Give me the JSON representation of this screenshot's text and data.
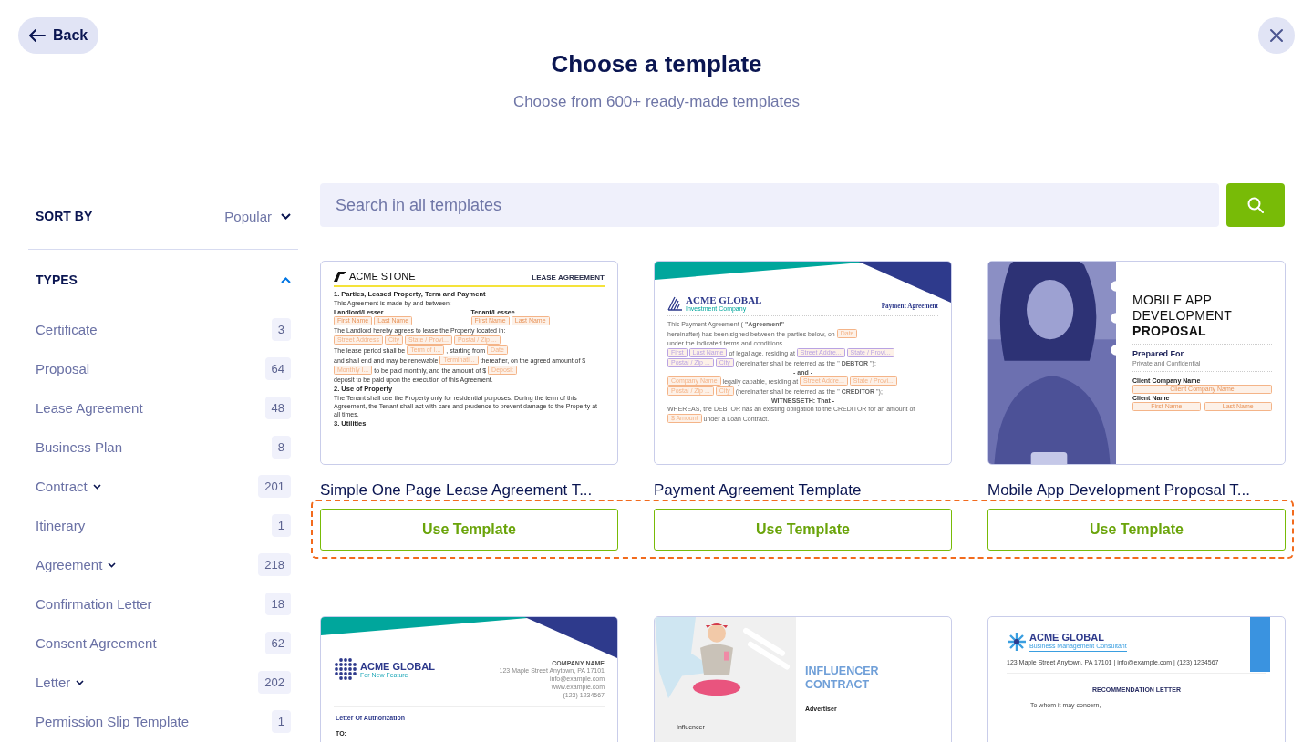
{
  "header": {
    "back": "Back",
    "title": "Choose a template",
    "subtitle": "Choose from 600+ ready-made templates"
  },
  "sidebar": {
    "sort_label": "SORT BY",
    "sort_value": "Popular",
    "types_label": "TYPES",
    "types_expanded": true,
    "types": [
      {
        "label": "Certificate",
        "count": "3",
        "expandable": false
      },
      {
        "label": "Proposal",
        "count": "64",
        "expandable": false
      },
      {
        "label": "Lease Agreement",
        "count": "48",
        "expandable": false
      },
      {
        "label": "Business Plan",
        "count": "8",
        "expandable": false
      },
      {
        "label": "Contract",
        "count": "201",
        "expandable": true
      },
      {
        "label": "Itinerary",
        "count": "1",
        "expandable": false
      },
      {
        "label": "Agreement",
        "count": "218",
        "expandable": true
      },
      {
        "label": "Confirmation Letter",
        "count": "18",
        "expandable": false
      },
      {
        "label": "Consent Agreement",
        "count": "62",
        "expandable": false
      },
      {
        "label": "Letter",
        "count": "202",
        "expandable": true
      },
      {
        "label": "Permission Slip Template",
        "count": "1",
        "expandable": false
      }
    ]
  },
  "search": {
    "placeholder": "Search in all templates"
  },
  "highlight_first_row_buttons": true,
  "templates": [
    {
      "title": "Simple One Page Lease Agreement T...",
      "button": "Use Template",
      "preview": {
        "kind": "lease",
        "brand": "ACME STONE",
        "doc_title": "LEASE AGREEMENT",
        "blocks": [
          {
            "kind": "heading",
            "text": "1. Parties, Leased Property, Term and Payment"
          },
          {
            "kind": "para",
            "parts": [
              {
                "kind": "text",
                "text": "This Agreement is made by and between:"
              }
            ]
          },
          {
            "kind": "split",
            "columns": [
              {
                "label": "Landlord/Lesser",
                "fields": [
                  "First Name",
                  "Last Name"
                ]
              },
              {
                "label": "Tenant/Lessee",
                "fields": [
                  "First Name",
                  "Last Name"
                ]
              }
            ]
          },
          {
            "kind": "para",
            "parts": [
              {
                "kind": "text",
                "text": "The Landlord hereby agrees to lease the Property located in:"
              }
            ]
          },
          {
            "kind": "para",
            "parts": [
              {
                "kind": "field",
                "text": "Street Address",
                "color": "#f4b488"
              },
              {
                "kind": "field",
                "text": "City",
                "color": "#f4b488"
              },
              {
                "kind": "field",
                "text": "State / Provi...",
                "color": "#f4b488"
              },
              {
                "kind": "field",
                "text": "Postal / Zip ...",
                "color": "#f4b488"
              }
            ]
          },
          {
            "kind": "para",
            "parts": [
              {
                "kind": "text",
                "text": "The lease period shall be"
              },
              {
                "kind": "field",
                "text": "Term of I...",
                "color": "#f4b488"
              },
              {
                "kind": "text",
                "text": ", starting from"
              },
              {
                "kind": "field",
                "text": "Date",
                "color": "#f4b488"
              },
              {
                "kind": "text",
                "text": "and shall end and may be renewable"
              },
              {
                "kind": "field",
                "text": "Terminati...",
                "color": "#f4b488"
              },
              {
                "kind": "text",
                "text": "thereafter, on the agreed amount of $"
              },
              {
                "kind": "field",
                "text": "Monthly I...",
                "color": "#f4b488"
              },
              {
                "kind": "text",
                "text": "to be paid monthly, and the amount of $"
              },
              {
                "kind": "field",
                "text": "Deposit",
                "color": "#f4b488"
              },
              {
                "kind": "text",
                "text": "deposit to be paid upon the execution of this Agreement."
              }
            ]
          },
          {
            "kind": "heading",
            "text": "2. Use of Property"
          },
          {
            "kind": "para",
            "parts": [
              {
                "kind": "text",
                "text": "The Tenant shall use the Property only for residential purposes. During the term of this Agreement, the Tenant shall act with care and prudence to prevent damage to the Property at all times."
              }
            ]
          },
          {
            "kind": "heading",
            "text": "3. Utilities"
          }
        ]
      }
    },
    {
      "title": "Payment Agreement Template",
      "button": "Use Template",
      "preview": {
        "kind": "payment",
        "brand": "ACME GLOBAL",
        "tagline": "Investment Company",
        "doc_title": "Payment Agreement",
        "blocks": [
          {
            "kind": "para",
            "parts": [
              {
                "kind": "text",
                "text": "This Payment Agreement ("
              },
              {
                "kind": "strong",
                "text": "\"Agreement\""
              },
              {
                "kind": "text",
                "text": "hereinafter) has been signed between the parties below, on"
              },
              {
                "kind": "field",
                "text": "Date",
                "color": "#f4b488"
              },
              {
                "kind": "text",
                "text": "under the indicated terms and conditions."
              }
            ]
          },
          {
            "kind": "para",
            "parts": [
              {
                "kind": "field",
                "text": "First",
                "color": "#b9a3e3"
              },
              {
                "kind": "field",
                "text": "Last Name",
                "color": "#b9a3e3"
              },
              {
                "kind": "text",
                "text": "of legal age, residing at"
              },
              {
                "kind": "field",
                "text": "Street Addre...",
                "color": "#b9a3e3"
              },
              {
                "kind": "field",
                "text": "State / Provi...",
                "color": "#b9a3e3"
              },
              {
                "kind": "field",
                "text": "Postal / Zip ...",
                "color": "#b9a3e3"
              },
              {
                "kind": "field",
                "text": "City",
                "color": "#b9a3e3"
              },
              {
                "kind": "text",
                "text": "(hereinafter shall be referred as the \""
              },
              {
                "kind": "strong",
                "text": "DEBTOR"
              },
              {
                "kind": "text",
                "text": "\");"
              }
            ]
          },
          {
            "kind": "center",
            "text": "- and -"
          },
          {
            "kind": "para",
            "parts": [
              {
                "kind": "field",
                "text": "Company Name",
                "color": "#f4b488"
              },
              {
                "kind": "text",
                "text": "legally capable, residing at"
              },
              {
                "kind": "field",
                "text": "Street Addre...",
                "color": "#f4b488"
              },
              {
                "kind": "field",
                "text": "State / Provi...",
                "color": "#f4b488"
              },
              {
                "kind": "field",
                "text": "Postal / Zip ...",
                "color": "#f4b488"
              },
              {
                "kind": "field",
                "text": "City",
                "color": "#f4b488"
              },
              {
                "kind": "text",
                "text": "(hereinafter shall be referred as the \""
              },
              {
                "kind": "strong",
                "text": "CREDITOR"
              },
              {
                "kind": "text",
                "text": "\");"
              }
            ]
          },
          {
            "kind": "center",
            "text": "WITNESSETH: That -"
          },
          {
            "kind": "para",
            "parts": [
              {
                "kind": "text",
                "text": "WHEREAS, the DEBTOR has an existing obligation to the CREDITOR for an amount of"
              },
              {
                "kind": "field",
                "text": "$ Amount",
                "color": "#f4b488"
              },
              {
                "kind": "text",
                "text": "under a Loan Contract."
              }
            ]
          }
        ]
      }
    },
    {
      "title": "Mobile App Development Proposal T...",
      "button": "Use Template",
      "preview": {
        "kind": "proposal",
        "title_lines": [
          "MOBILE APP",
          "DEVELOPMENT"
        ],
        "title_bold": "PROPOSAL",
        "prepared": "Prepared For",
        "note": "Private and Confidential",
        "company_label": "Client Company Name",
        "company_field": "Client Company Name",
        "name_label": "Client Name",
        "name_fields": [
          "First Name",
          "Last Name"
        ]
      }
    },
    {
      "preview": {
        "kind": "authorization",
        "brand": "ACME GLOBAL",
        "tagline": "For New Feature",
        "company": "COMPANY NAME",
        "contact": [
          "123 Maple Street Anytown, PA 17101",
          "info@example.com",
          "www.example.com",
          "(123) 1234567"
        ],
        "doc_title": "Letter Of Authorization",
        "to": "TO:"
      }
    },
    {
      "preview": {
        "kind": "influencer",
        "title_lines": [
          "INFLUENCER",
          "CONTRACT"
        ],
        "left_label": "Influencer",
        "right_label": "Advertiser"
      }
    },
    {
      "preview": {
        "kind": "recommendation",
        "brand": "ACME GLOBAL",
        "tagline": "Business Management Consultant",
        "contact": "123 Maple Street Anytown, PA 17101  |  info@example.com   |  (123) 1234567",
        "doc_title": "RECOMMENDATION LETTER",
        "greeting": "To whom it may concern,"
      }
    }
  ]
}
